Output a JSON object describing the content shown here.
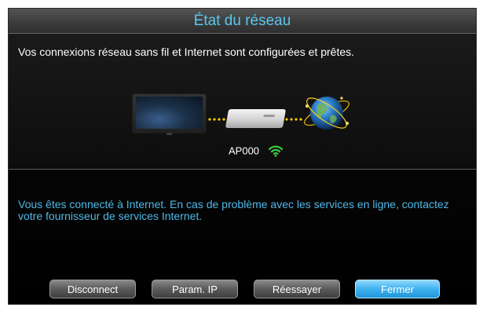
{
  "dialog": {
    "title": "État du réseau",
    "status_message": "Vos connexions réseau sans fil et Internet sont configurées et prêtes.",
    "network": {
      "access_point": "AP000",
      "icons": [
        "tv-icon",
        "router-icon",
        "globe-icon",
        "wifi-signal-icon"
      ]
    },
    "info_message": "Vous êtes connecté à Internet. En cas de problème avec les services en ligne, contactez votre fournisseur de services Internet.",
    "buttons": {
      "disconnect": "Disconnect",
      "ip_settings": "Param. IP",
      "retry": "Réessayer",
      "close": "Fermer"
    }
  },
  "colors": {
    "title_text": "#59c7ef",
    "info_text": "#4fb8e8",
    "link_dots": "#ffcc00",
    "wifi": "#3ccf3c",
    "focused_button": "#3fb2ef"
  }
}
